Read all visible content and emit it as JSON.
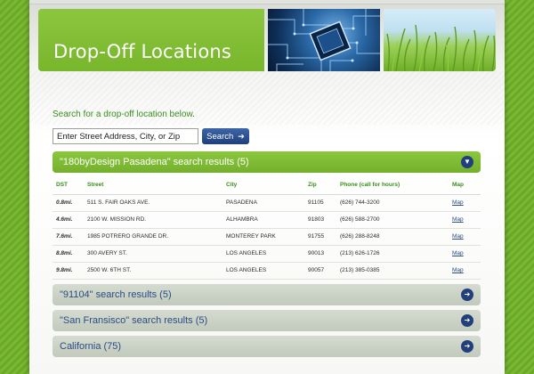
{
  "header": {
    "title": "Drop-Off Locations"
  },
  "search": {
    "intro": "Search for a drop-off location below.",
    "placeholder": "Enter Street Address, City, or Zip",
    "button_label": "Search",
    "button_icon": "arrow-right-icon"
  },
  "results": {
    "active": {
      "heading": "\"180byDesign Pasadena\" search results (5)",
      "toggle_icon": "chevron-down-icon",
      "columns": [
        "DST",
        "Street",
        "City",
        "Zip",
        "Phone (call for hours)",
        "Map"
      ],
      "rows": [
        {
          "dst": "0.8mi.",
          "street": "511 S. FAIR OAKS AVE.",
          "city": "PASADENA",
          "zip": "91105",
          "phone": "(626) 744-3200",
          "map": "Map"
        },
        {
          "dst": "4.6mi.",
          "street": "2100 W. MISSION RD.",
          "city": "ALHAMBRA",
          "zip": "91803",
          "phone": "(626) 588-2700",
          "map": "Map"
        },
        {
          "dst": "7.6mi.",
          "street": "1985 POTRERO GRANDE DR.",
          "city": "MONTEREY PARK",
          "zip": "91755",
          "phone": "(626) 288-8248",
          "map": "Map"
        },
        {
          "dst": "8.8mi.",
          "street": "300 AVERY ST.",
          "city": "LOS ANGELES",
          "zip": "90013",
          "phone": "(213) 626-1726",
          "map": "Map"
        },
        {
          "dst": "9.8mi.",
          "street": "2500 W. 6TH ST.",
          "city": "LOS ANGELES",
          "zip": "90057",
          "phone": "(213) 385-0385",
          "map": "Map"
        }
      ]
    },
    "collapsed": [
      {
        "heading": "\"91104\" search results (5)",
        "toggle_icon": "arrow-right-icon"
      },
      {
        "heading": "\"San Fransisco\" search results (5)",
        "toggle_icon": "arrow-right-icon"
      },
      {
        "heading": "California (75)",
        "toggle_icon": "arrow-right-icon"
      }
    ]
  },
  "colors": {
    "brand_green": "#8cc63f",
    "accent_blue": "#213f7a",
    "label_green": "#3a8f1c"
  }
}
